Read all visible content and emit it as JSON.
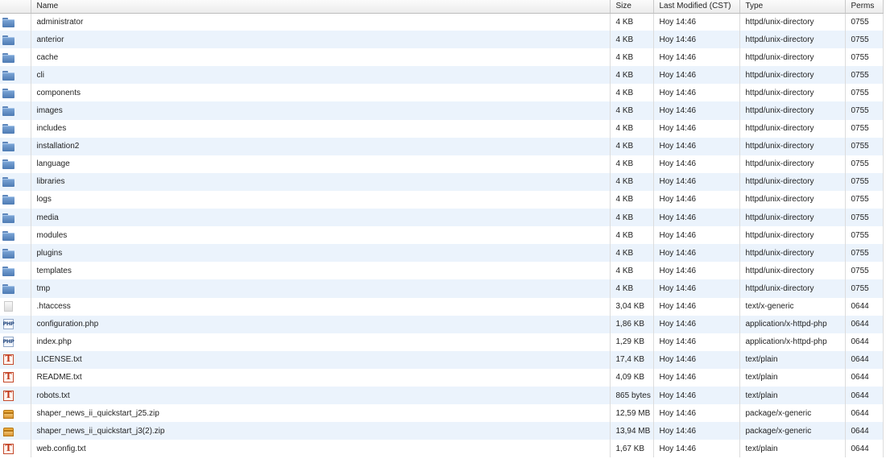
{
  "columns": {
    "name": "Name",
    "size": "Size",
    "modified": "Last Modified (CST)",
    "type": "Type",
    "perms": "Perms"
  },
  "files": [
    {
      "icon": "folder-icon",
      "name": "administrator",
      "size": "4 KB",
      "modified": "Hoy 14:46",
      "type": "httpd/unix-directory",
      "perms": "0755"
    },
    {
      "icon": "folder-icon",
      "name": "anterior",
      "size": "4 KB",
      "modified": "Hoy 14:46",
      "type": "httpd/unix-directory",
      "perms": "0755"
    },
    {
      "icon": "folder-icon",
      "name": "cache",
      "size": "4 KB",
      "modified": "Hoy 14:46",
      "type": "httpd/unix-directory",
      "perms": "0755"
    },
    {
      "icon": "folder-icon",
      "name": "cli",
      "size": "4 KB",
      "modified": "Hoy 14:46",
      "type": "httpd/unix-directory",
      "perms": "0755"
    },
    {
      "icon": "folder-icon",
      "name": "components",
      "size": "4 KB",
      "modified": "Hoy 14:46",
      "type": "httpd/unix-directory",
      "perms": "0755"
    },
    {
      "icon": "folder-icon",
      "name": "images",
      "size": "4 KB",
      "modified": "Hoy 14:46",
      "type": "httpd/unix-directory",
      "perms": "0755"
    },
    {
      "icon": "folder-icon",
      "name": "includes",
      "size": "4 KB",
      "modified": "Hoy 14:46",
      "type": "httpd/unix-directory",
      "perms": "0755"
    },
    {
      "icon": "folder-icon",
      "name": "installation2",
      "size": "4 KB",
      "modified": "Hoy 14:46",
      "type": "httpd/unix-directory",
      "perms": "0755"
    },
    {
      "icon": "folder-icon",
      "name": "language",
      "size": "4 KB",
      "modified": "Hoy 14:46",
      "type": "httpd/unix-directory",
      "perms": "0755"
    },
    {
      "icon": "folder-icon",
      "name": "libraries",
      "size": "4 KB",
      "modified": "Hoy 14:46",
      "type": "httpd/unix-directory",
      "perms": "0755"
    },
    {
      "icon": "folder-icon",
      "name": "logs",
      "size": "4 KB",
      "modified": "Hoy 14:46",
      "type": "httpd/unix-directory",
      "perms": "0755"
    },
    {
      "icon": "folder-icon",
      "name": "media",
      "size": "4 KB",
      "modified": "Hoy 14:46",
      "type": "httpd/unix-directory",
      "perms": "0755"
    },
    {
      "icon": "folder-icon",
      "name": "modules",
      "size": "4 KB",
      "modified": "Hoy 14:46",
      "type": "httpd/unix-directory",
      "perms": "0755"
    },
    {
      "icon": "folder-icon",
      "name": "plugins",
      "size": "4 KB",
      "modified": "Hoy 14:46",
      "type": "httpd/unix-directory",
      "perms": "0755"
    },
    {
      "icon": "folder-icon",
      "name": "templates",
      "size": "4 KB",
      "modified": "Hoy 14:46",
      "type": "httpd/unix-directory",
      "perms": "0755"
    },
    {
      "icon": "folder-icon",
      "name": "tmp",
      "size": "4 KB",
      "modified": "Hoy 14:46",
      "type": "httpd/unix-directory",
      "perms": "0755"
    },
    {
      "icon": "generic-file-icon",
      "name": ".htaccess",
      "size": "3,04 KB",
      "modified": "Hoy 14:46",
      "type": "text/x-generic",
      "perms": "0644"
    },
    {
      "icon": "php-file-icon",
      "name": "configuration.php",
      "size": "1,86 KB",
      "modified": "Hoy 14:46",
      "type": "application/x-httpd-php",
      "perms": "0644"
    },
    {
      "icon": "php-file-icon",
      "name": "index.php",
      "size": "1,29 KB",
      "modified": "Hoy 14:46",
      "type": "application/x-httpd-php",
      "perms": "0644"
    },
    {
      "icon": "text-file-icon",
      "name": "LICENSE.txt",
      "size": "17,4 KB",
      "modified": "Hoy 14:46",
      "type": "text/plain",
      "perms": "0644"
    },
    {
      "icon": "text-file-icon",
      "name": "README.txt",
      "size": "4,09 KB",
      "modified": "Hoy 14:46",
      "type": "text/plain",
      "perms": "0644"
    },
    {
      "icon": "text-file-icon",
      "name": "robots.txt",
      "size": "865 bytes",
      "modified": "Hoy 14:46",
      "type": "text/plain",
      "perms": "0644"
    },
    {
      "icon": "package-icon",
      "name": "shaper_news_ii_quickstart_j25.zip",
      "size": "12,59 MB",
      "modified": "Hoy 14:46",
      "type": "package/x-generic",
      "perms": "0644"
    },
    {
      "icon": "package-icon",
      "name": "shaper_news_ii_quickstart_j3(2).zip",
      "size": "13,94 MB",
      "modified": "Hoy 14:46",
      "type": "package/x-generic",
      "perms": "0644"
    },
    {
      "icon": "text-file-icon",
      "name": "web.config.txt",
      "size": "1,67 KB",
      "modified": "Hoy 14:46",
      "type": "text/plain",
      "perms": "0644"
    }
  ]
}
